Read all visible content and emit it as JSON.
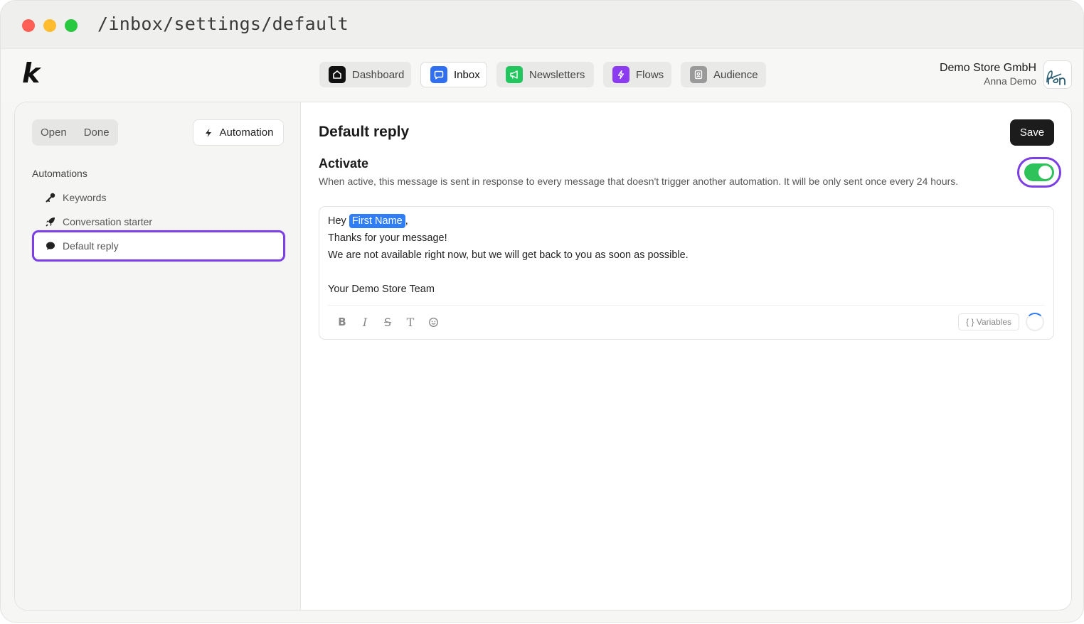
{
  "window": {
    "path": "/inbox/settings/default"
  },
  "brand": {
    "logo": "k"
  },
  "nav": [
    {
      "label": "Dashboard",
      "icon": "home-icon",
      "color": "#111111"
    },
    {
      "label": "Inbox",
      "icon": "chat-icon",
      "color": "#2f6ff0",
      "active": true
    },
    {
      "label": "Newsletters",
      "icon": "megaphone-icon",
      "color": "#22c55e"
    },
    {
      "label": "Flows",
      "icon": "lightning-icon",
      "color": "#8b3cf0"
    },
    {
      "label": "Audience",
      "icon": "contact-book-icon",
      "color": "#9a9a9a"
    }
  ],
  "account": {
    "company": "Demo Store GmbH",
    "user": "Anna Demo"
  },
  "sidebar": {
    "segments": [
      "Open",
      "Done"
    ],
    "automation_label": "Automation",
    "section_title": "Automations",
    "items": [
      {
        "label": "Keywords",
        "icon": "key-icon"
      },
      {
        "label": "Conversation starter",
        "icon": "rocket-icon"
      },
      {
        "label": "Default reply",
        "icon": "chat-bubble-icon",
        "selected": true
      }
    ]
  },
  "main": {
    "title": "Default reply",
    "save_label": "Save",
    "activate": {
      "title": "Activate",
      "description": "When active, this message is sent in response to every message that doesn't trigger another automation. It will be only sent once every 24 hours.",
      "enabled": true
    },
    "editor": {
      "greeting": "Hey",
      "variable_chip": "First Name",
      "after_chip": ",",
      "line2": "Thanks for your message!",
      "line3": "We are not available right now, but we will get back to you as soon as possible.",
      "line5": "Your Demo Store Team",
      "toolbar": {
        "bold": "B",
        "italic": "I",
        "strike": "S",
        "font": "T"
      },
      "variables_label": "{ } Variables"
    }
  },
  "colors": {
    "accent": "#7b3fe4",
    "toggle_on": "#2fc25a",
    "chip": "#2f7ef5",
    "save_bg": "#1c1c1c"
  }
}
